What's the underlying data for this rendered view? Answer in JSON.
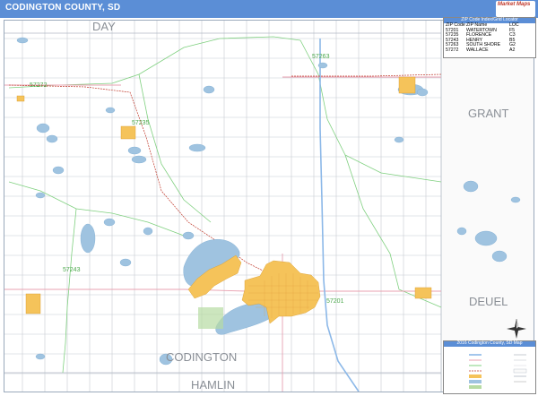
{
  "title": "CODINGTON COUNTY, SD",
  "logo": {
    "line1": "Market Maps",
    "line2": ""
  },
  "counties": {
    "center": "CODINGTON",
    "north": "DAY",
    "east_upper": "GRANT",
    "east_lower": "DEUEL",
    "south": "HAMLIN"
  },
  "zip_labels": [
    "57263",
    "57272",
    "57235",
    "57243",
    "57201"
  ],
  "zip_locator": {
    "title": "ZIP Code Index/Grid Locator",
    "headers": [
      "ZIP Code",
      "ZIP Name",
      "LOC"
    ],
    "rows": [
      [
        "57201",
        "WATERTOWN",
        "F5"
      ],
      [
        "57235",
        "FLORENCE",
        "C3"
      ],
      [
        "57243",
        "HENRY",
        "B5"
      ],
      [
        "57263",
        "SOUTH SHORE",
        "G2"
      ],
      [
        "57272",
        "WALLACE",
        "A2"
      ]
    ]
  },
  "legend": {
    "title": "2016 Codington County, SD Map",
    "subtitle": "",
    "items_left": [
      "",
      "",
      "",
      "",
      "",
      "",
      "",
      ""
    ],
    "items_right": [
      "",
      "",
      "",
      "",
      "",
      ""
    ]
  },
  "colors": {
    "title_bar": "#5b8ed6",
    "water": "#9fc3e0",
    "urban": "#f5c35a",
    "road": "#b9bec6",
    "highway": "#8cb8e8",
    "railroad": "#c0392b",
    "zip_boundary": "#7fd07f",
    "state_road": "#e8a0b0",
    "park": "#b7dba3"
  }
}
